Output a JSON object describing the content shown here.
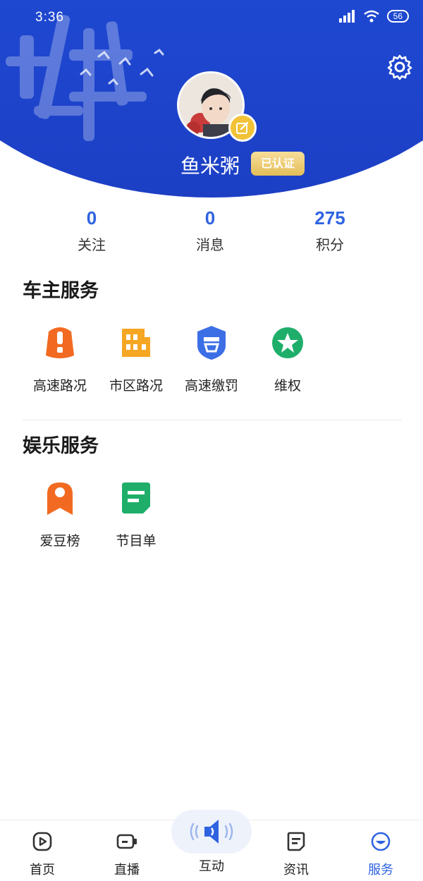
{
  "status_bar": {
    "time": "3:36",
    "battery": "56"
  },
  "profile": {
    "username": "鱼米粥",
    "verified_label": "已认证"
  },
  "stats": [
    {
      "value": "0",
      "label": "关注"
    },
    {
      "value": "0",
      "label": "消息"
    },
    {
      "value": "275",
      "label": "积分"
    }
  ],
  "sections": {
    "owner": {
      "title": "车主服务",
      "items": [
        {
          "label": "高速路况",
          "icon": "highway-icon",
          "color": "#f26a21"
        },
        {
          "label": "市区路况",
          "icon": "city-icon",
          "color": "#f5a623"
        },
        {
          "label": "高速缴罚",
          "icon": "fine-icon",
          "color": "#3c6fe6"
        },
        {
          "label": "维权",
          "icon": "star-icon",
          "color": "#1fae6a"
        }
      ]
    },
    "entertainment": {
      "title": "娱乐服务",
      "items": [
        {
          "label": "爱豆榜",
          "icon": "ribbon-icon",
          "color": "#f26a21"
        },
        {
          "label": "节目单",
          "icon": "program-icon",
          "color": "#1fae6a"
        }
      ]
    }
  },
  "nav": [
    {
      "label": "首页",
      "icon": "home-play-icon"
    },
    {
      "label": "直播",
      "icon": "live-icon"
    },
    {
      "label": "互动",
      "icon": "speaker-icon"
    },
    {
      "label": "资讯",
      "icon": "news-icon"
    },
    {
      "label": "服务",
      "icon": "service-icon"
    }
  ],
  "colors": {
    "primary": "#1f4fd6",
    "accent": "#2f63e0",
    "badge": "#e3bd58"
  }
}
